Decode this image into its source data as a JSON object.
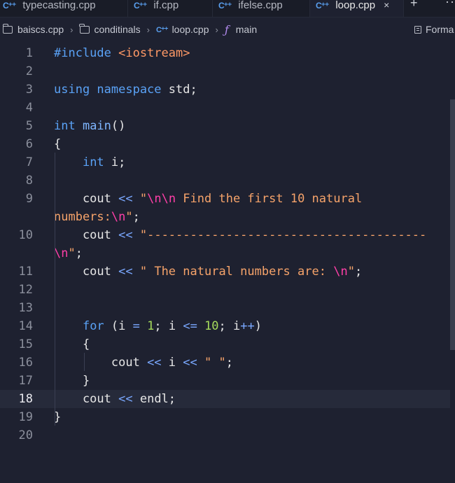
{
  "tabs": [
    {
      "label": "typecasting.cpp",
      "icon": "c++-icon",
      "active": false
    },
    {
      "label": "if.cpp",
      "icon": "c++-icon",
      "active": false
    },
    {
      "label": "ifelse.cpp",
      "icon": "c++-icon",
      "active": false
    },
    {
      "label": "loop.cpp",
      "icon": "c++-icon",
      "active": true,
      "close": "×"
    }
  ],
  "tab_actions": {
    "new_tab": "+",
    "more": "···"
  },
  "breadcrumb": {
    "root": "baiscs.cpp",
    "folder": "conditinals",
    "file": "loop.cpp",
    "symbol": "main",
    "separator": "›"
  },
  "format_label": "Forma",
  "current_line": 18,
  "lines": [
    {
      "n": "1",
      "tokens": [
        [
          "pp",
          "#include "
        ],
        [
          "inc",
          "<iostream>"
        ]
      ]
    },
    {
      "n": "2",
      "tokens": []
    },
    {
      "n": "3",
      "tokens": [
        [
          "kw",
          "using namespace "
        ],
        [
          "plain",
          "std;"
        ]
      ]
    },
    {
      "n": "4",
      "tokens": []
    },
    {
      "n": "5",
      "tokens": [
        [
          "kw",
          "int "
        ],
        [
          "fn",
          "main"
        ],
        [
          "plain",
          "()"
        ]
      ]
    },
    {
      "n": "6",
      "tokens": [
        [
          "plain",
          "{"
        ]
      ]
    },
    {
      "n": "7",
      "tokens": [
        [
          "plain",
          "    "
        ],
        [
          "kw",
          "int "
        ],
        [
          "plain",
          "i;"
        ]
      ]
    },
    {
      "n": "8",
      "tokens": []
    },
    {
      "n": "9",
      "tokens": [
        [
          "plain",
          "    cout "
        ],
        [
          "op",
          "<<"
        ],
        [
          "plain",
          " "
        ],
        [
          "str",
          "\""
        ],
        [
          "esc",
          "\\n\\n"
        ],
        [
          "str",
          " Find the first "
        ],
        [
          "str",
          "10 natural"
        ]
      ]
    },
    {
      "n": "",
      "tokens": [
        [
          "str",
          "numbers:"
        ],
        [
          "esc",
          "\\n"
        ],
        [
          "str",
          "\""
        ],
        [
          "plain",
          ";"
        ]
      ]
    },
    {
      "n": "10",
      "tokens": [
        [
          "plain",
          "    cout "
        ],
        [
          "op",
          "<<"
        ],
        [
          "plain",
          " "
        ],
        [
          "str",
          "\"---------------------------------------"
        ]
      ]
    },
    {
      "n": "",
      "tokens": [
        [
          "esc",
          "\\n"
        ],
        [
          "str",
          "\""
        ],
        [
          "plain",
          ";"
        ]
      ]
    },
    {
      "n": "11",
      "tokens": [
        [
          "plain",
          "    cout "
        ],
        [
          "op",
          "<<"
        ],
        [
          "plain",
          " "
        ],
        [
          "str",
          "\" The natural numbers are: "
        ],
        [
          "esc",
          "\\n"
        ],
        [
          "str",
          "\""
        ],
        [
          "plain",
          ";"
        ]
      ]
    },
    {
      "n": "12",
      "tokens": []
    },
    {
      "n": "13",
      "tokens": []
    },
    {
      "n": "14",
      "tokens": [
        [
          "plain",
          "    "
        ],
        [
          "kw",
          "for "
        ],
        [
          "plain",
          "(i "
        ],
        [
          "op",
          "="
        ],
        [
          "plain",
          " "
        ],
        [
          "num",
          "1"
        ],
        [
          "plain",
          "; i "
        ],
        [
          "op",
          "<="
        ],
        [
          "plain",
          " "
        ],
        [
          "num",
          "10"
        ],
        [
          "plain",
          "; i"
        ],
        [
          "op",
          "++"
        ],
        [
          "plain",
          ")"
        ]
      ]
    },
    {
      "n": "15",
      "tokens": [
        [
          "plain",
          "    {"
        ]
      ]
    },
    {
      "n": "16",
      "tokens": [
        [
          "plain",
          "        cout "
        ],
        [
          "op",
          "<<"
        ],
        [
          "plain",
          " i "
        ],
        [
          "op",
          "<<"
        ],
        [
          "plain",
          " "
        ],
        [
          "str",
          "\" \""
        ],
        [
          "plain",
          ";"
        ]
      ]
    },
    {
      "n": "17",
      "tokens": [
        [
          "plain",
          "    }"
        ]
      ]
    },
    {
      "n": "18",
      "tokens": [
        [
          "plain",
          "    cout "
        ],
        [
          "op",
          "<<"
        ],
        [
          "plain",
          " endl;"
        ]
      ]
    },
    {
      "n": "19",
      "tokens": [
        [
          "plain",
          "}"
        ]
      ]
    },
    {
      "n": "20",
      "tokens": []
    }
  ]
}
